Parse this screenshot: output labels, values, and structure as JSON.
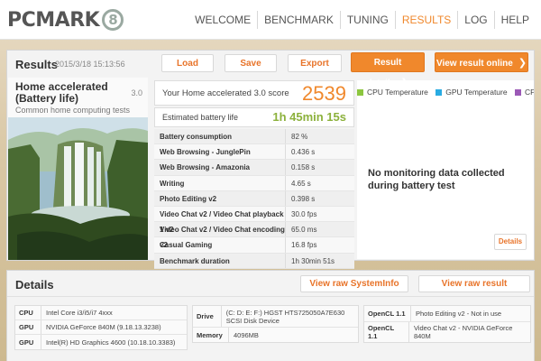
{
  "app": {
    "logo_text": "PCMARK",
    "logo_mark": "8"
  },
  "nav": {
    "items": [
      {
        "label": "WELCOME"
      },
      {
        "label": "BENCHMARK"
      },
      {
        "label": "TUNING"
      },
      {
        "label": "RESULTS",
        "active": true
      },
      {
        "label": "LOG"
      },
      {
        "label": "HELP"
      }
    ],
    "active_color": "#f0882c"
  },
  "results": {
    "title": "Results",
    "date": "2015/3/18 15:13:56",
    "buttons": {
      "load": "Load",
      "save": "Save",
      "export": "Export",
      "result_details": "Result details",
      "view_online": "View result online"
    },
    "benchmark": {
      "name": "Home accelerated (Battery life)",
      "version": "3.0",
      "subtitle": "Common home computing tests"
    },
    "score_label": "Your Home accelerated 3.0 score",
    "score_value": "2539",
    "battery_label": "Estimated battery life",
    "battery_value": "1h 45min 15s",
    "metrics": [
      {
        "name": "Battery consumption",
        "value": "82 %"
      },
      {
        "name": "Web Browsing - JunglePin",
        "value": "0.436 s"
      },
      {
        "name": "Web Browsing - Amazonia",
        "value": "0.158 s"
      },
      {
        "name": "Writing",
        "value": "4.65 s"
      },
      {
        "name": "Photo Editing v2",
        "value": "0.398 s"
      },
      {
        "name": "Video Chat v2 / Video Chat playback 1 v2",
        "value": "30.0 fps"
      },
      {
        "name": "Video Chat v2 / Video Chat encoding v2",
        "value": "65.0 ms"
      },
      {
        "name": "Casual Gaming",
        "value": "16.8 fps"
      },
      {
        "name": "Benchmark duration",
        "value": "1h 30min 51s"
      }
    ],
    "monitor": {
      "legend": [
        {
          "label": "CPU Temperature",
          "color": "#8cc63f"
        },
        {
          "label": "GPU Temperature",
          "color": "#29abe2"
        },
        {
          "label": "CPU Clc",
          "color": "#9b59b6"
        }
      ],
      "no_data": "No monitoring data collected during battery test",
      "details_label": "Details"
    }
  },
  "details": {
    "title": "Details",
    "view_systeminfo": "View raw SystemInfo",
    "view_raw_result": "View raw result",
    "table1": [
      {
        "key": "CPU",
        "value": "Intel Core i3/i5/i7 4xxx"
      },
      {
        "key": "GPU",
        "value": "NVIDIA GeForce 840M (9.18.13.3238)"
      },
      {
        "key": "GPU",
        "value": "Intel(R) HD Graphics 4600 (10.18.10.3383)"
      }
    ],
    "table2": [
      {
        "key": "Drive",
        "value": "(C: D: E: F:) HGST  HTS725050A7E630 SCSI Disk Device"
      },
      {
        "key": "Memory",
        "value": "4096MB"
      }
    ],
    "table3": [
      {
        "key": "OpenCL 1.1",
        "value": "Photo Editing v2 - Not in use"
      },
      {
        "key": "OpenCL 1.1",
        "value": "Video Chat v2 - NVIDIA GeForce 840M"
      }
    ]
  }
}
